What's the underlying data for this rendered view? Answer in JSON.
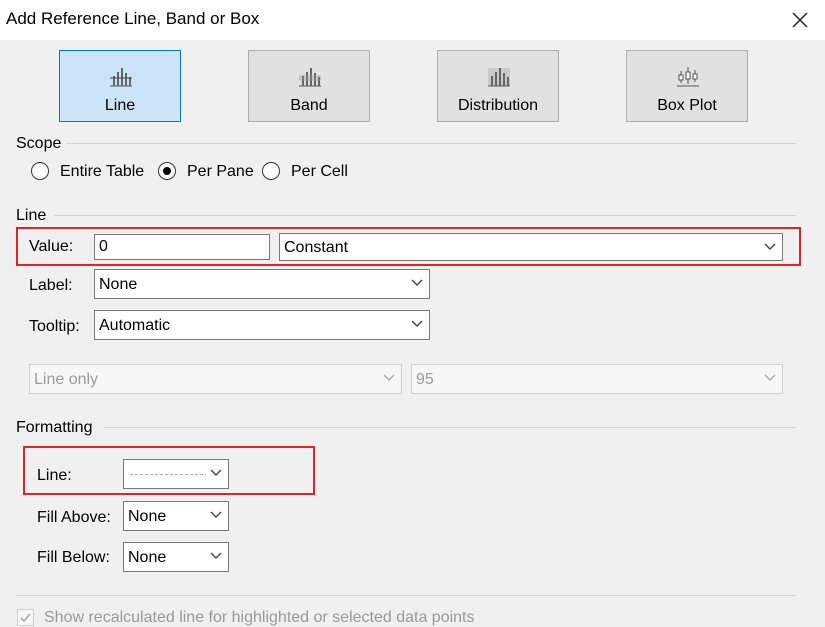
{
  "dialog": {
    "title": "Add Reference Line, Band or Box"
  },
  "types": [
    {
      "label": "Line",
      "selected": true
    },
    {
      "label": "Band"
    },
    {
      "label": "Distribution"
    },
    {
      "label": "Box Plot"
    }
  ],
  "scope": {
    "heading": "Scope",
    "options": [
      "Entire Table",
      "Per Pane",
      "Per Cell"
    ],
    "selected": "Per Pane"
  },
  "line": {
    "heading": "Line",
    "value_label": "Value:",
    "value": "0",
    "value_type": "Constant",
    "label_label": "Label:",
    "label_value": "None",
    "tooltip_label": "Tooltip:",
    "tooltip_value": "Automatic",
    "confidence_mode": "Line only",
    "confidence_level": "95"
  },
  "formatting": {
    "heading": "Formatting",
    "line_label": "Line:",
    "fill_above_label": "Fill Above:",
    "fill_above_value": "None",
    "fill_below_label": "Fill Below:",
    "fill_below_value": "None"
  },
  "recalc": {
    "label": "Show recalculated line for highlighted or selected data points",
    "checked": true
  },
  "colors": {
    "highlight": "#e02424",
    "selected_button": "#cce4f7",
    "accent": "#0078d7"
  }
}
